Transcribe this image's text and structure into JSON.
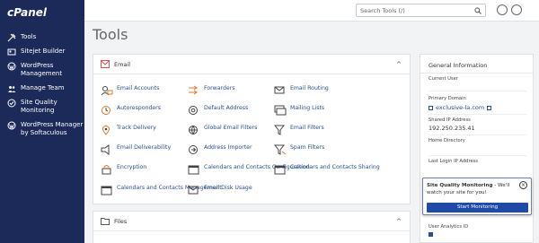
{
  "brand": {
    "logo": "cPanel"
  },
  "sidebar": {
    "items": [
      {
        "label": "Tools",
        "icon": "tools-icon"
      },
      {
        "label": "Sitejet Builder",
        "icon": "sitejet-icon"
      },
      {
        "label": "WordPress Management",
        "icon": "wordpress-icon"
      },
      {
        "label": "Manage Team",
        "icon": "team-icon"
      },
      {
        "label": "Site Quality Monitoring",
        "icon": "site-quality-icon"
      },
      {
        "label": "WordPress Manager by Softaculous",
        "icon": "wordpress-softaculous-icon"
      }
    ]
  },
  "topbar": {
    "search_placeholder": "Search Tools (/)"
  },
  "page": {
    "title": "Tools"
  },
  "email_panel": {
    "title": "Email",
    "tools": [
      {
        "label": "Email Accounts"
      },
      {
        "label": "Forwarders"
      },
      {
        "label": "Email Routing"
      },
      {
        "label": "Autoresponders"
      },
      {
        "label": "Default Address"
      },
      {
        "label": "Mailing Lists"
      },
      {
        "label": "Track Delivery"
      },
      {
        "label": "Global Email Filters"
      },
      {
        "label": "Email Filters"
      },
      {
        "label": "Email Deliverability"
      },
      {
        "label": "Address Importer"
      },
      {
        "label": "Spam Filters"
      },
      {
        "label": "Encryption"
      },
      {
        "label": "Calendars and Contacts Configuration"
      },
      {
        "label": "Calendars and Contacts Sharing"
      },
      {
        "label": "Calendars and Contacts Management"
      },
      {
        "label": "Email Disk Usage"
      }
    ]
  },
  "files_panel": {
    "title": "Files"
  },
  "general_info": {
    "title": "General Information",
    "current_user_label": "Current User",
    "primary_domain_label": "Primary Domain",
    "primary_domain_value": "exclusive-la.com",
    "shared_ip_label": "Shared IP Address",
    "shared_ip_value": "192.250.235.41",
    "home_dir_label": "Home Directory",
    "last_login_label": "Last Login IP Address",
    "user_analytics_label": "User Analytics ID"
  },
  "popup": {
    "title": "Site Quality Monitoring",
    "message": " - We'll watch your site for you!",
    "button": "Start Monitoring",
    "close": "×"
  },
  "colors": {
    "sidebar": "#1b2a59",
    "link": "#2a4f8f",
    "button": "#1f4aa8",
    "accent_orange": "#e07a28"
  }
}
